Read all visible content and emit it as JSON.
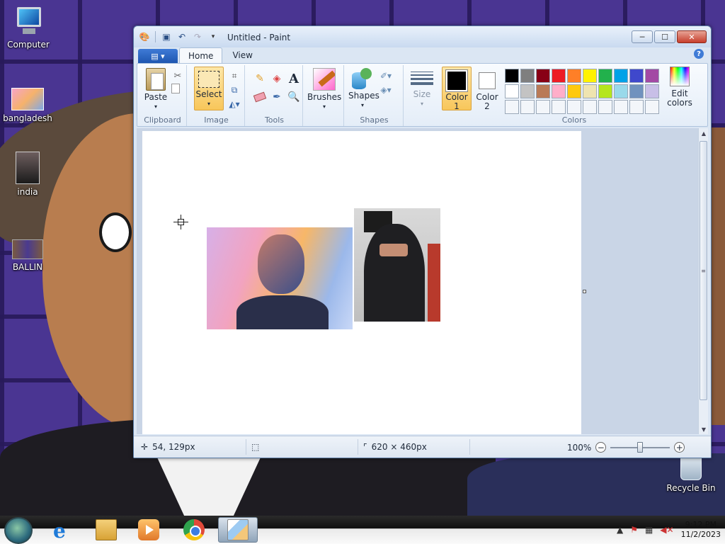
{
  "desktop": {
    "icons": [
      {
        "label": "Computer"
      },
      {
        "label": "bangladesh"
      },
      {
        "label": "india"
      },
      {
        "label": "BALLIN"
      },
      {
        "label": "Recycle Bin"
      }
    ]
  },
  "window": {
    "title": "Untitled - Paint",
    "controls": {
      "minimize": "─",
      "maximize": "☐",
      "close": "✕"
    },
    "tabs": {
      "file": "▤ ▾",
      "home": "Home",
      "view": "View"
    },
    "help": "?"
  },
  "ribbon": {
    "clipboard": {
      "label": "Clipboard",
      "paste": "Paste",
      "paste_arrow": "▾"
    },
    "image": {
      "label": "Image",
      "select": "Select",
      "select_arrow": "▾"
    },
    "tools": {
      "label": "Tools",
      "text_glyph": "A"
    },
    "brushes": {
      "label": "Brushes",
      "arrow": "▾"
    },
    "shapes": {
      "label": "Shapes",
      "shapes_btn": "Shapes",
      "arrow": "▾"
    },
    "size": {
      "label": "Size",
      "arrow": "▾"
    },
    "colors": {
      "label": "Colors",
      "color1": {
        "line1": "Color",
        "line2": "1",
        "value": "#000000"
      },
      "color2": {
        "line1": "Color",
        "line2": "2",
        "value": "#ffffff"
      },
      "edit_line1": "Edit",
      "edit_line2": "colors",
      "palette": [
        "#000000",
        "#7f7f7f",
        "#880015",
        "#ed1c24",
        "#ff7f27",
        "#fff200",
        "#22b14c",
        "#00a2e8",
        "#3f48cc",
        "#a349a4",
        "#ffffff",
        "#c3c3c3",
        "#b97a57",
        "#ffaec9",
        "#ffc90e",
        "#efe4b0",
        "#b5e61d",
        "#99d9ea",
        "#7092be",
        "#c8bfe7",
        "",
        "",
        "",
        "",
        "",
        "",
        "",
        "",
        "",
        ""
      ]
    }
  },
  "status": {
    "cursor_pos": "54, 129px",
    "canvas_size": "620 × 460px",
    "zoom": "100%",
    "zoom_level": 0.5
  },
  "taskbar": {
    "clock_time": "9:12 PM",
    "clock_date": "11/2/2023"
  }
}
